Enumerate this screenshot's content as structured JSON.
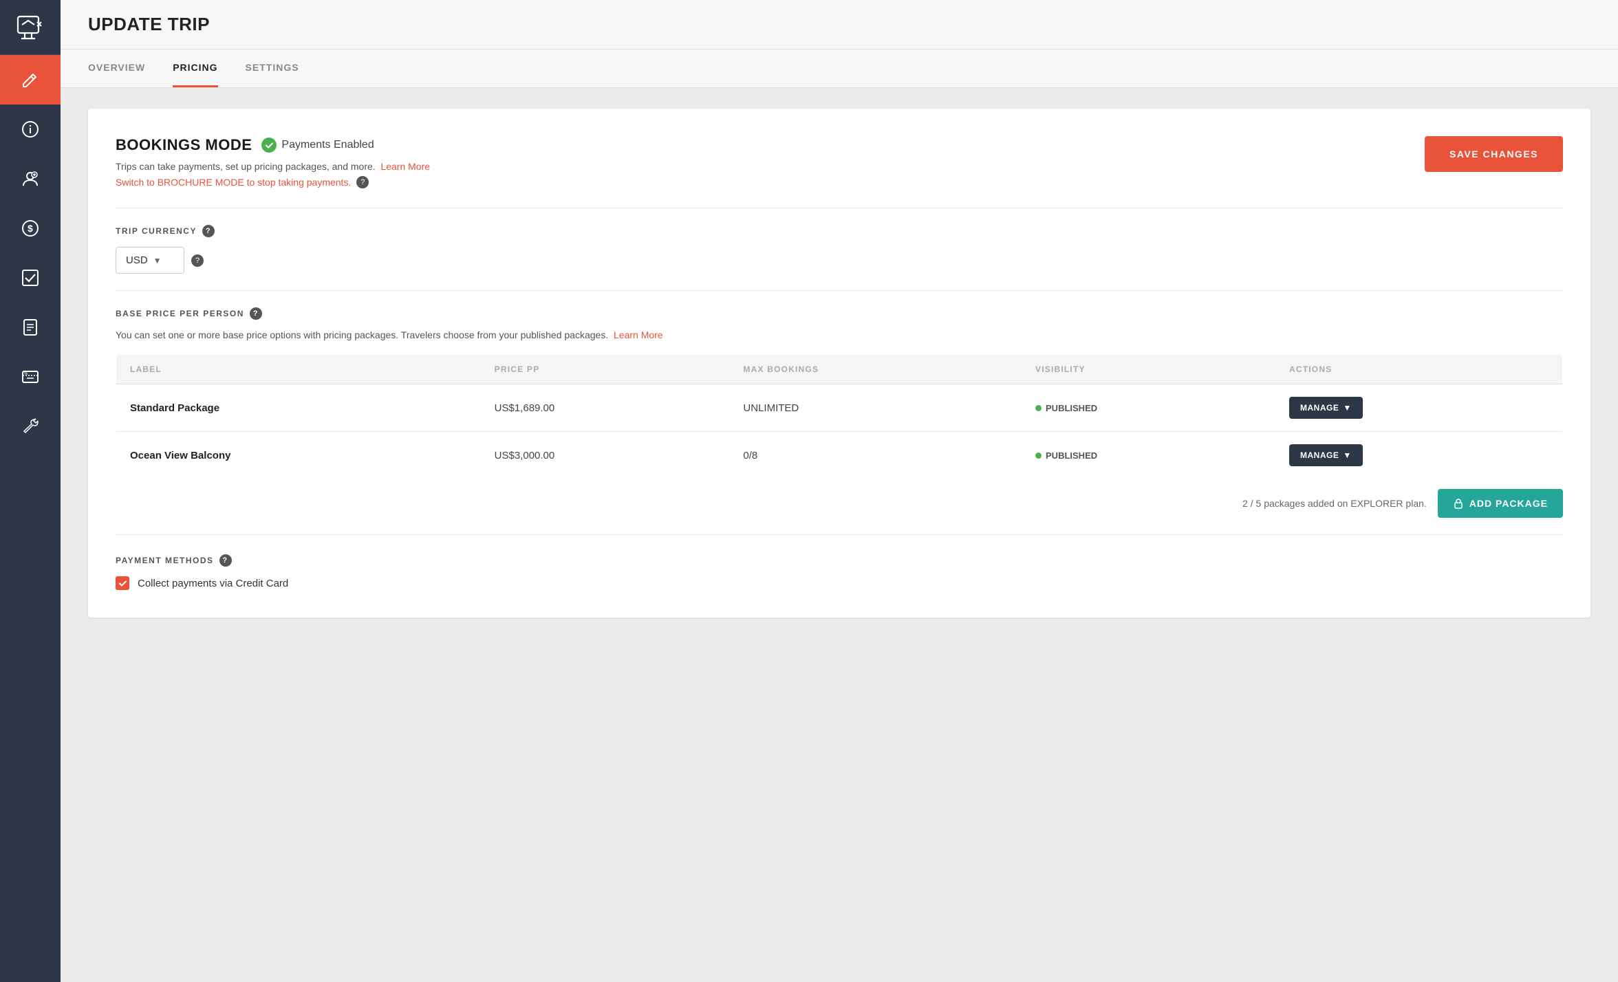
{
  "sidebar": {
    "items": [
      {
        "name": "chat-icon",
        "label": "Chat"
      },
      {
        "name": "edit-icon",
        "label": "Edit",
        "active": true
      },
      {
        "name": "info-icon",
        "label": "Info"
      },
      {
        "name": "person-icon",
        "label": "Person"
      },
      {
        "name": "dollar-icon",
        "label": "Dollar"
      },
      {
        "name": "check-icon",
        "label": "Check"
      },
      {
        "name": "document-icon",
        "label": "Document"
      },
      {
        "name": "ticket-icon",
        "label": "Ticket"
      },
      {
        "name": "wrench-icon",
        "label": "Wrench"
      }
    ]
  },
  "header": {
    "title": "UPDATE TRIP"
  },
  "tabs": [
    {
      "label": "OVERVIEW",
      "active": false
    },
    {
      "label": "PRICING",
      "active": true
    },
    {
      "label": "SETTINGS",
      "active": false
    }
  ],
  "bookings_mode": {
    "title": "BOOKINGS MODE",
    "payments_enabled": "Payments Enabled",
    "description": "Trips can take payments, set up pricing packages, and more.",
    "learn_more": "Learn More",
    "switch_text": "Switch to BROCHURE MODE to stop taking payments.",
    "save_changes": "SAVE CHANGES"
  },
  "trip_currency": {
    "label": "TRIP CURRENCY",
    "value": "USD"
  },
  "base_price": {
    "label": "BASE PRICE PER PERSON",
    "description": "You can set one or more base price options with pricing packages. Travelers choose from your published packages.",
    "learn_more": "Learn More",
    "columns": [
      "Label",
      "PRICE PP",
      "MAX BOOKINGS",
      "VISIBILITY",
      "ACTIONS"
    ],
    "rows": [
      {
        "label": "Standard Package",
        "price": "US$1,689.00",
        "max_bookings": "UNLIMITED",
        "visibility": "PUBLISHED",
        "action": "MANAGE"
      },
      {
        "label": "Ocean View Balcony",
        "price": "US$3,000.00",
        "max_bookings": "0/8",
        "visibility": "PUBLISHED",
        "action": "MANAGE"
      }
    ],
    "packages_count": "2 / 5 packages added on EXPLORER plan.",
    "add_package": "ADD PACKAGE"
  },
  "payment_methods": {
    "label": "PAYMENT METHODS",
    "collect_credit_card_label": "Collect payments via Credit Card"
  }
}
